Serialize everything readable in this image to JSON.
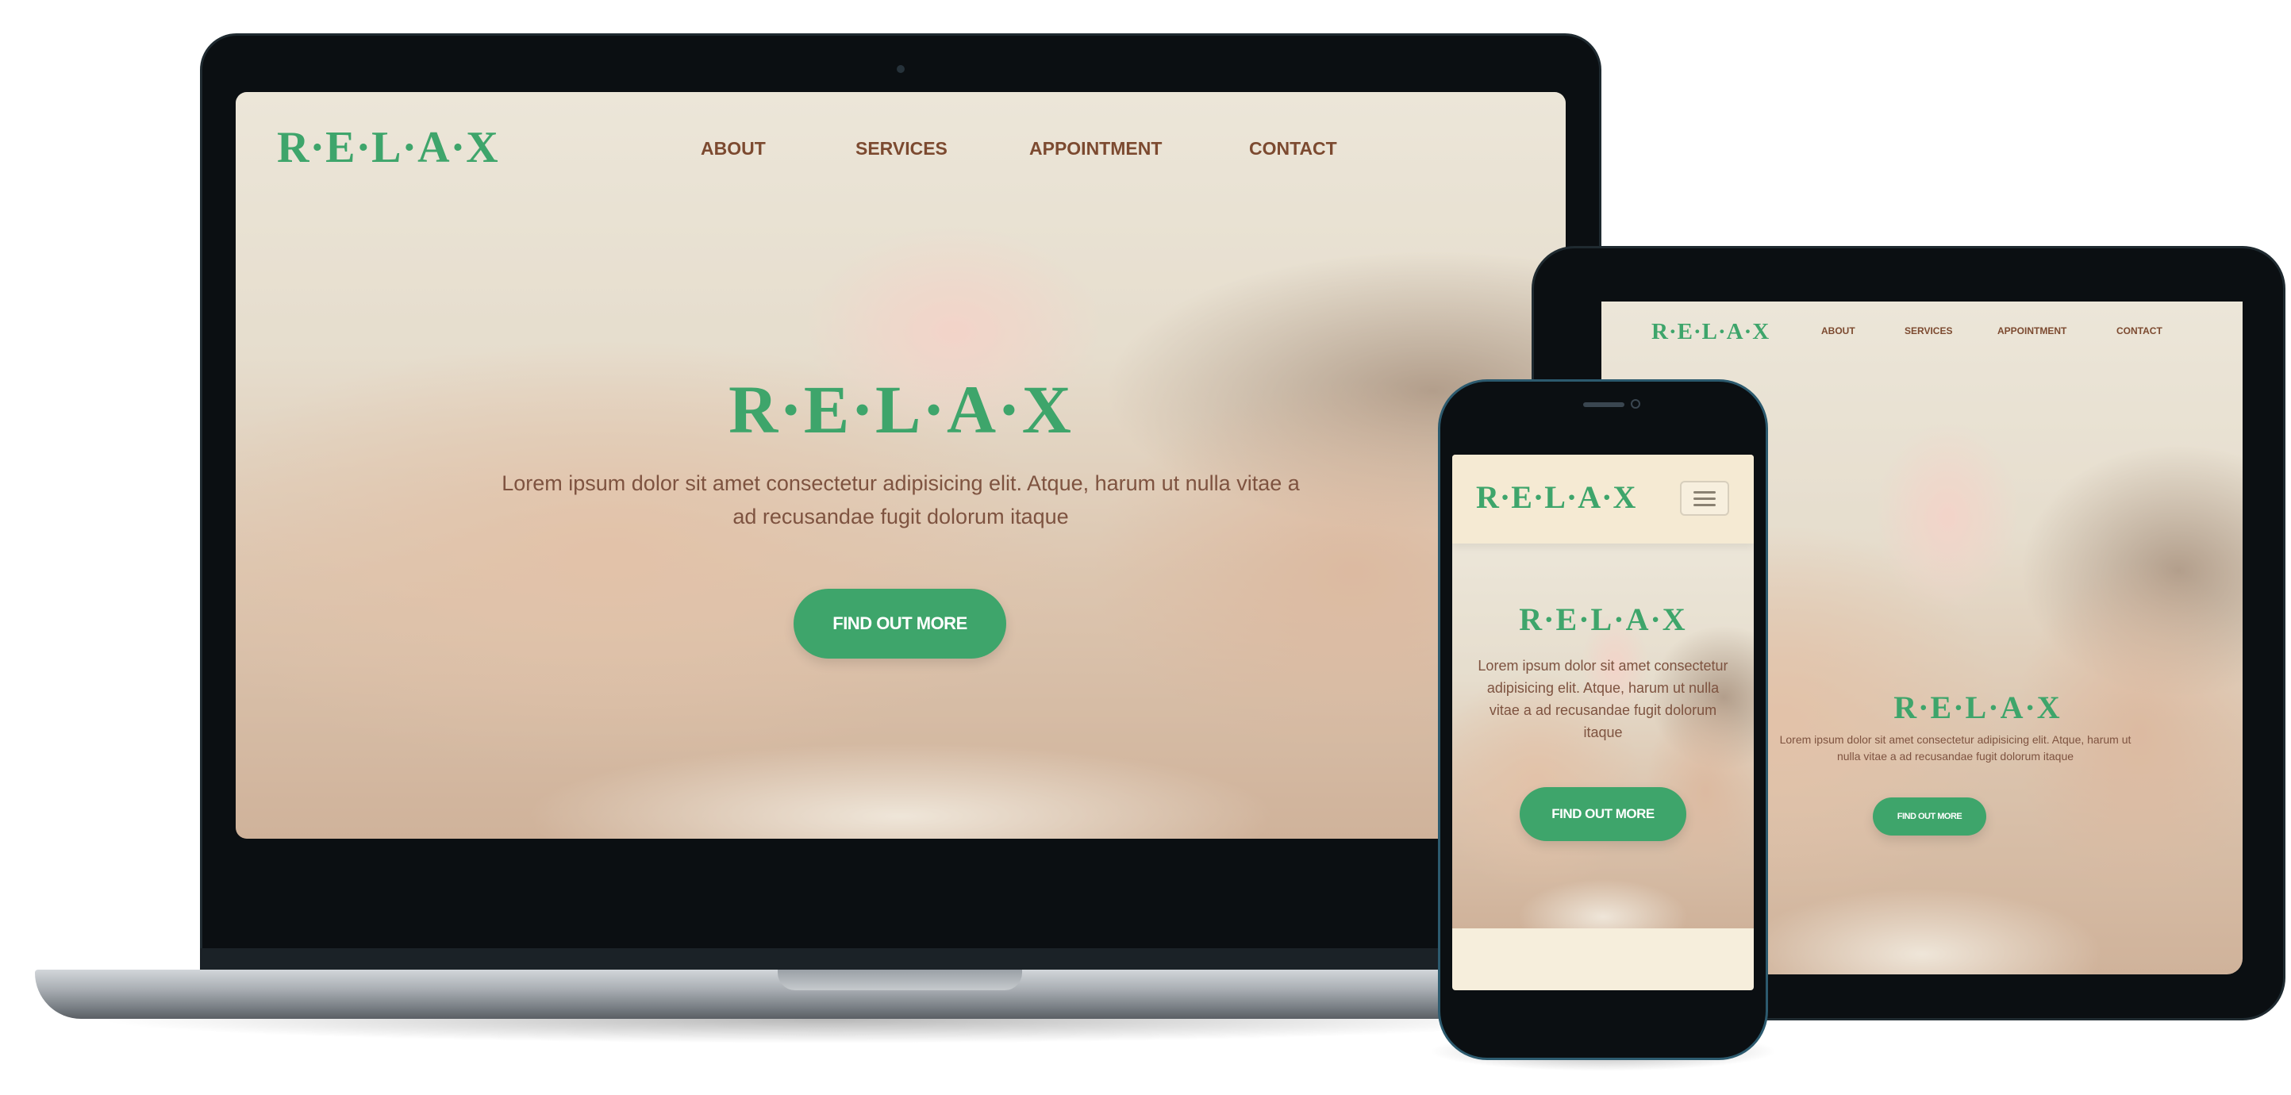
{
  "brand": {
    "logo": "R·E·L·A·X"
  },
  "nav": {
    "about": "ABOUT",
    "services": "SERVICES",
    "appointment": "APPOINTMENT",
    "contact": "CONTACT"
  },
  "hero": {
    "title": "R·E·L·A·X",
    "text": "Lorem ipsum dolor sit amet consectetur adipisicing elit. Atque, harum ut nulla vitae a ad recusandae fugit dolorum itaque",
    "button": "FIND OUT MORE"
  },
  "colors": {
    "accent": "#3ea56b",
    "nav_text": "#7c4a30",
    "device": "#0b0f12"
  },
  "icons": {
    "menu": "hamburger-icon",
    "camera": "camera-icon"
  }
}
